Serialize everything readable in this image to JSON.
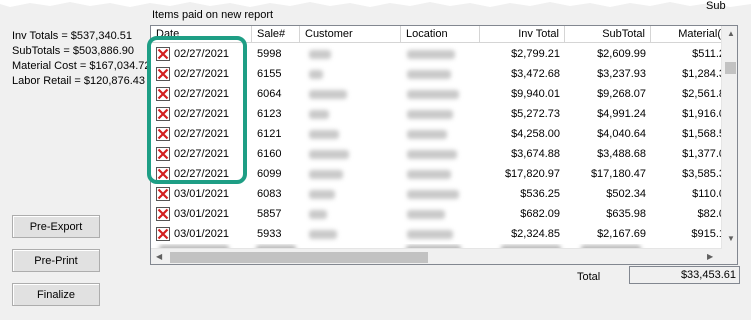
{
  "summary": {
    "inv_totals": "Inv Totals = $537,340.51",
    "subtotals": "SubTotals = $503,886.90",
    "material_cost": "Material Cost = $167,034.72",
    "labor_retail": "Labor Retail = $120,876.43"
  },
  "buttons": {
    "pre_export": "Pre-Export",
    "pre_print": "Pre-Print",
    "finalize": "Finalize"
  },
  "grid": {
    "title": "Items paid on new report",
    "top_right_fragment": "Sub",
    "columns": {
      "date": "Date",
      "sale": "Sale#",
      "customer": "Customer",
      "location": "Location",
      "inv_total": "Inv Total",
      "subtotal": "SubTotal",
      "material": "Material("
    },
    "rows": [
      {
        "date": "02/27/2021",
        "sale": "5998",
        "inv_total": "$2,799.21",
        "subtotal": "$2,609.99",
        "material": "$511.2"
      },
      {
        "date": "02/27/2021",
        "sale": "6155",
        "inv_total": "$3,472.68",
        "subtotal": "$3,237.93",
        "material": "$1,284.3"
      },
      {
        "date": "02/27/2021",
        "sale": "6064",
        "inv_total": "$9,940.01",
        "subtotal": "$9,268.07",
        "material": "$2,561.8"
      },
      {
        "date": "02/27/2021",
        "sale": "6123",
        "inv_total": "$5,272.73",
        "subtotal": "$4,991.24",
        "material": "$1,916.0"
      },
      {
        "date": "02/27/2021",
        "sale": "6121",
        "inv_total": "$4,258.00",
        "subtotal": "$4,040.64",
        "material": "$1,568.5"
      },
      {
        "date": "02/27/2021",
        "sale": "6160",
        "inv_total": "$3,674.88",
        "subtotal": "$3,488.68",
        "material": "$1,377.0"
      },
      {
        "date": "02/27/2021",
        "sale": "6099",
        "inv_total": "$17,820.97",
        "subtotal": "$17,180.47",
        "material": "$3,585.3"
      },
      {
        "date": "03/01/2021",
        "sale": "6083",
        "inv_total": "$536.25",
        "subtotal": "$502.34",
        "material": "$110.0"
      },
      {
        "date": "03/01/2021",
        "sale": "5857",
        "inv_total": "$682.09",
        "subtotal": "$635.98",
        "material": "$82.0"
      },
      {
        "date": "03/01/2021",
        "sale": "5933",
        "inv_total": "$2,324.85",
        "subtotal": "$2,167.69",
        "material": "$915.1"
      }
    ]
  },
  "footer": {
    "total_label": "Total",
    "total_value": "$33,453.61"
  },
  "colors": {
    "highlight": "#1e9e85",
    "x_icon_red": "#d21f1f"
  }
}
